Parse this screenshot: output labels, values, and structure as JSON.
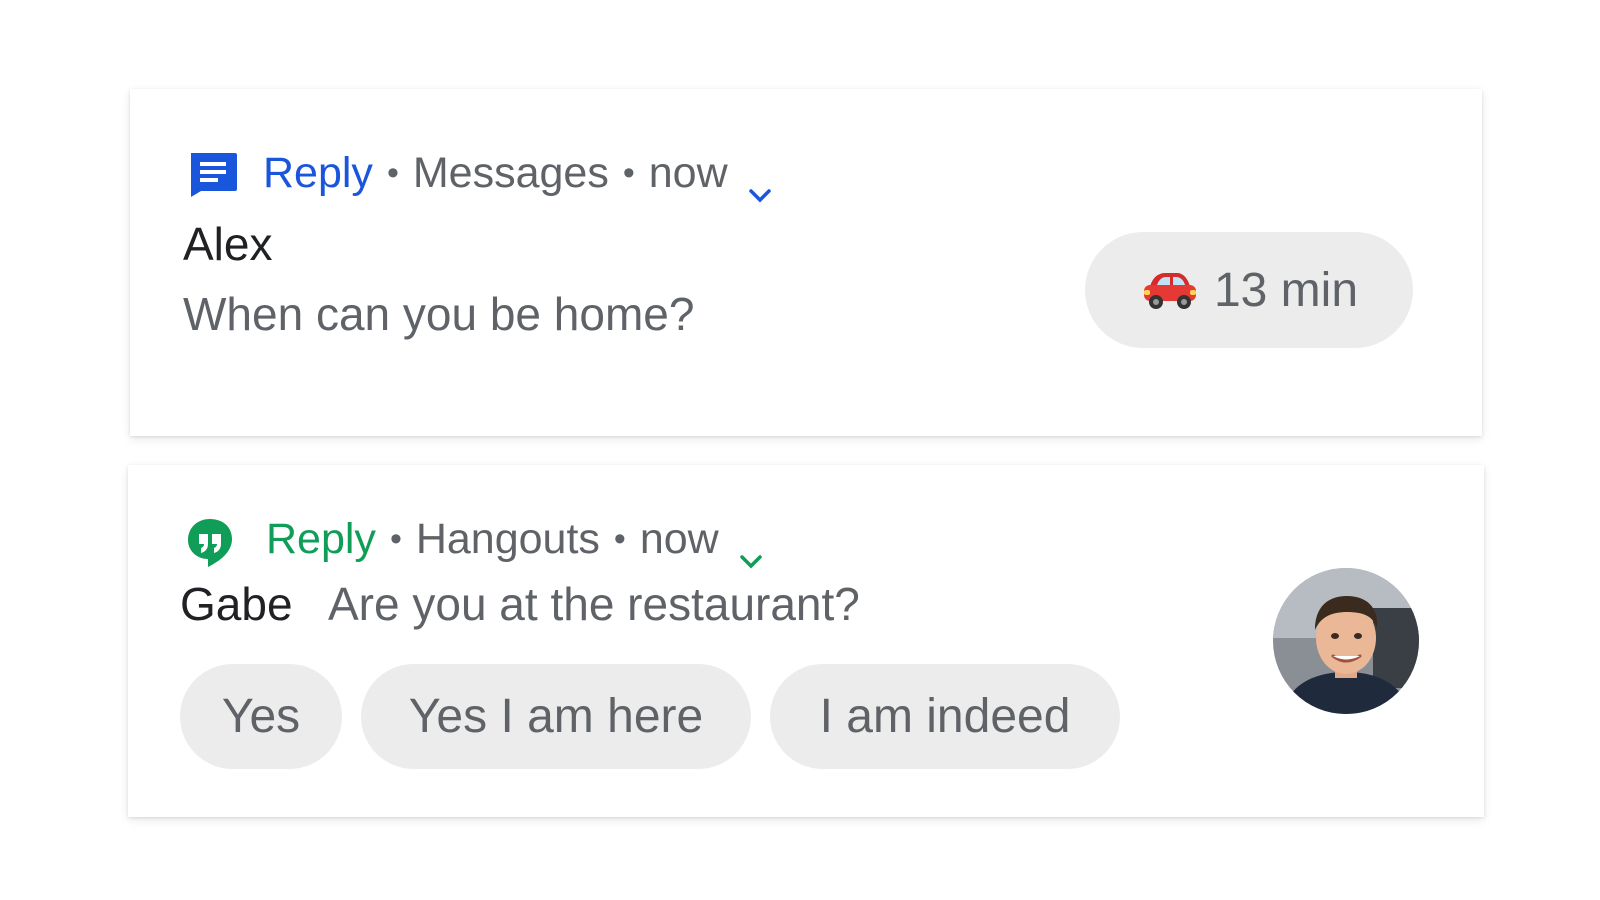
{
  "notifications": [
    {
      "reply_label": "Reply",
      "app_name": "Messages",
      "time": "now",
      "app_icon": "messages-icon",
      "accent_color": "#1a56db",
      "sender": "Alex",
      "message": "When can you be home?",
      "chip": {
        "emoji_icon": "car-icon",
        "label": "13 min"
      }
    },
    {
      "reply_label": "Reply",
      "app_name": "Hangouts",
      "time": "now",
      "app_icon": "hangouts-icon",
      "accent_color": "#0f9d58",
      "sender": "Gabe",
      "message": "Are you at the restaurant?",
      "smart_replies": [
        "Yes",
        "Yes I am here",
        "I am indeed"
      ],
      "avatar": "contact-avatar"
    }
  ],
  "colors": {
    "secondary_text": "#5f6368",
    "primary_text": "#202124",
    "chip_background": "#ececec"
  }
}
